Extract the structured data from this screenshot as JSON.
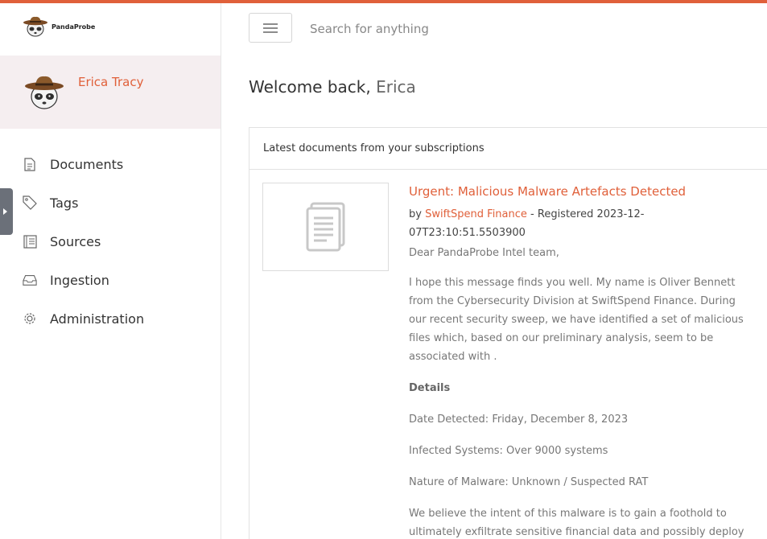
{
  "brand": {
    "name": "PandaProbe"
  },
  "user": {
    "name": "Erica Tracy"
  },
  "nav": [
    {
      "label": "Documents",
      "icon": "document-icon"
    },
    {
      "label": "Tags",
      "icon": "tag-icon"
    },
    {
      "label": "Sources",
      "icon": "sources-icon"
    },
    {
      "label": "Ingestion",
      "icon": "inbox-icon"
    },
    {
      "label": "Administration",
      "icon": "gear-icon"
    }
  ],
  "search": {
    "placeholder": "Search for anything"
  },
  "welcome": {
    "prefix": "Welcome back,",
    "first_name": "Erica"
  },
  "panel": {
    "header": "Latest documents from your subscriptions",
    "doc": {
      "title": "Urgent: Malicious Malware Artefacts Detected",
      "by_label": "by",
      "source": "SwiftSpend Finance",
      "registered": " -  Registered 2023-12-07T23:10:51.5503900",
      "greeting": "Dear PandaProbe Intel team,",
      "paragraph1": "I hope this message finds you well. My name is Oliver Bennett from the Cybersecurity Division at SwiftSpend Finance. During our recent security sweep, we have identified a set of malicious files which, based on our preliminary analysis, seem to be associated with .",
      "details_heading": "Details",
      "date_detected": "Date Detected: Friday, December 8, 2023",
      "infected": "Infected Systems: Over 9000 systems",
      "nature": "Nature of Malware: Unknown / Suspected RAT",
      "paragraph2": "We believe the intent of this malware is to gain a foothold to ultimately exfiltrate sensitive financial data and possibly deploy"
    }
  },
  "colors": {
    "accent": "#e0603a",
    "user_block_bg": "#f5eef0"
  }
}
